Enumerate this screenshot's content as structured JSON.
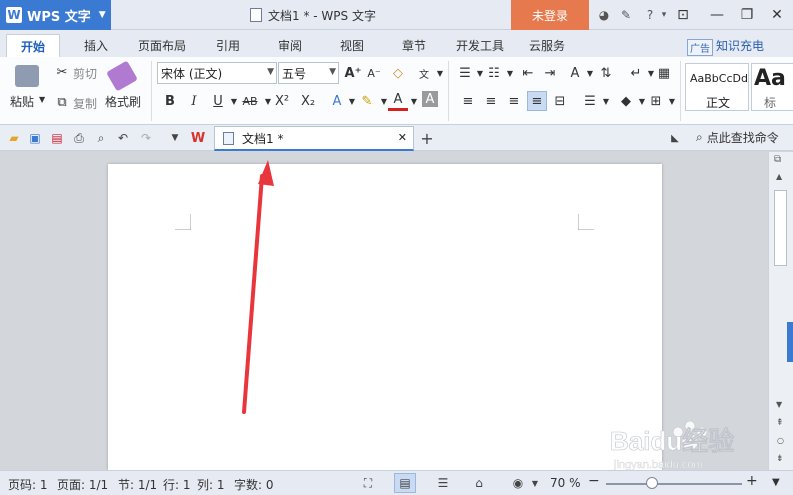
{
  "titlebar": {
    "app_name": "WPS 文字",
    "doc_title": "文档1 * - WPS 文字",
    "login": "未登录"
  },
  "ribbon_tabs": [
    "开始",
    "插入",
    "页面布局",
    "引用",
    "审阅",
    "视图",
    "章节",
    "开发工具",
    "云服务"
  ],
  "ribbon_right": {
    "ad": "广告",
    "knowledge": "知识充电"
  },
  "clipboard": {
    "paste": "粘贴",
    "cut": "剪切",
    "copy": "复制",
    "format_painter": "格式刷"
  },
  "font": {
    "name": "宋体 (正文)",
    "size": "五号"
  },
  "styles": {
    "normal_preview": "AaBbCcDd",
    "normal_label": "正文",
    "heading_preview": "Aa",
    "heading_label": "标"
  },
  "doc_tab": {
    "label": "文档1 *"
  },
  "search_command": "点此查找命令",
  "status": {
    "page_num": "页码: 1",
    "pages": "页面: 1/1",
    "section": "节: 1/1",
    "line": "行: 1",
    "column": "列: 1",
    "words": "字数: 0",
    "zoom": "70 %"
  },
  "zoom_percent": 70,
  "watermark": {
    "brand": "Baidu经验",
    "url": "jingyan.baidu.com"
  },
  "colors": {
    "accent": "#3b7ad3",
    "login": "#e67a4e",
    "arrow": "#e8363c"
  }
}
